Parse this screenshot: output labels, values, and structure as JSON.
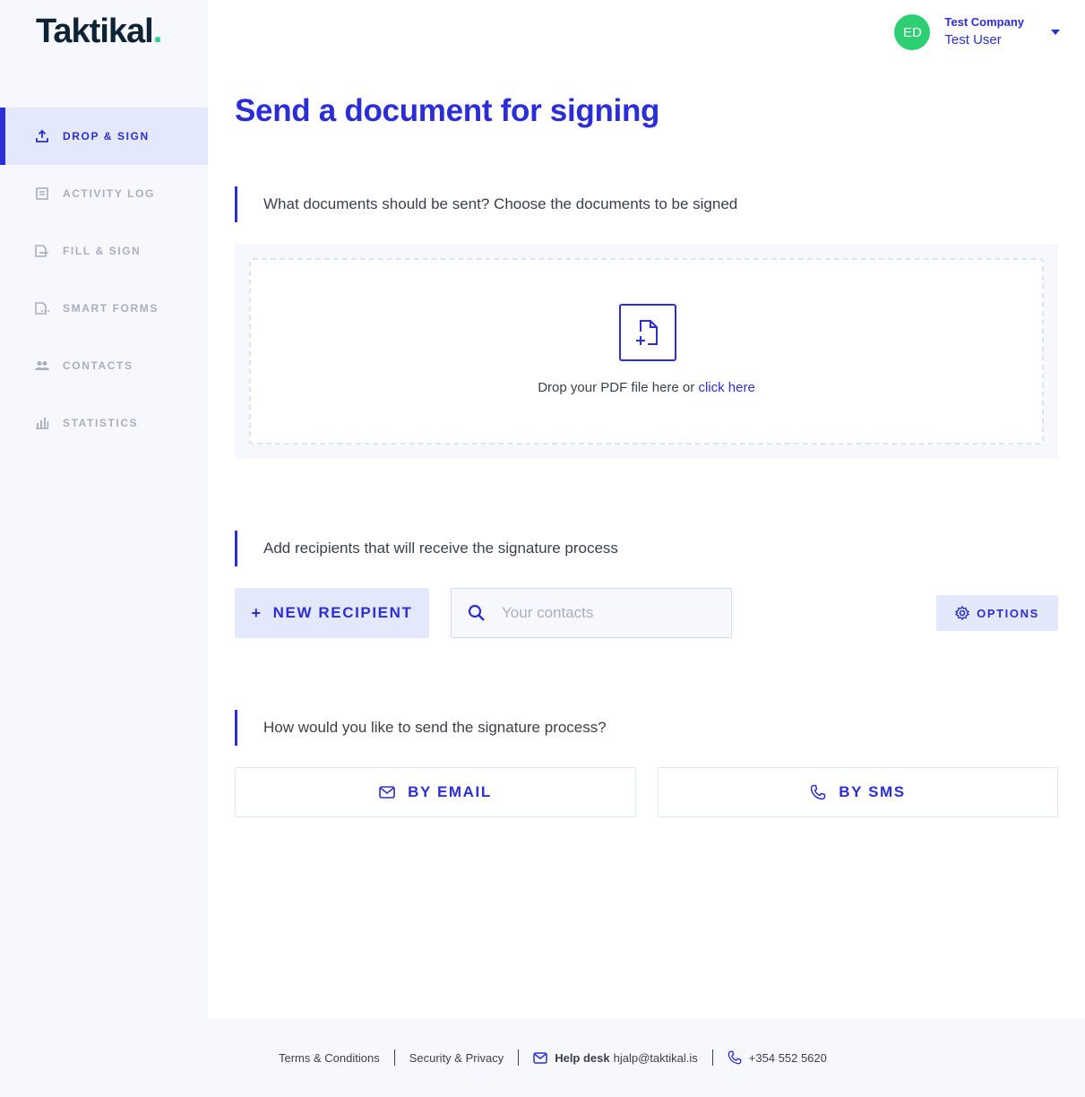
{
  "brand": {
    "name": "Taktikal",
    "dot": "."
  },
  "sidebar": {
    "items": [
      {
        "label": "DROP & SIGN",
        "icon": "upload-icon",
        "active": true
      },
      {
        "label": "ACTIVITY LOG",
        "icon": "document-list-icon",
        "active": false
      },
      {
        "label": "FILL & SIGN",
        "icon": "document-pen-icon",
        "active": false
      },
      {
        "label": "SMART FORMS",
        "icon": "document-dots-icon",
        "active": false
      },
      {
        "label": "CONTACTS",
        "icon": "people-icon",
        "active": false
      },
      {
        "label": "STATISTICS",
        "icon": "bar-chart-icon",
        "active": false
      }
    ]
  },
  "user": {
    "initials": "ED",
    "company": "Test Company",
    "name": "Test User"
  },
  "main": {
    "title": "Send a document for signing",
    "documents": {
      "prompt": "What documents should be sent? Choose the documents to be signed",
      "drop_text": "Drop your PDF file here or ",
      "drop_link": "click here"
    },
    "recipients": {
      "prompt": "Add recipients that will receive the signature process",
      "new_recipient_plus": "+",
      "new_recipient": "NEW RECIPIENT",
      "search_placeholder": "Your contacts",
      "options": "OPTIONS"
    },
    "send": {
      "prompt": "How would you like to send the signature process?",
      "by_email": "BY EMAIL",
      "by_sms": "BY SMS"
    }
  },
  "footer": {
    "terms": "Terms & Conditions",
    "security": "Security & Privacy",
    "helpdesk_label": "Help desk",
    "helpdesk_email": "hjalp@taktikal.is",
    "phone": "+354 552 5620"
  },
  "colors": {
    "accent": "#2b2ed6",
    "avatar": "#2ecf72",
    "brand_dot": "#2dd28a",
    "muted": "#a9aec0"
  }
}
